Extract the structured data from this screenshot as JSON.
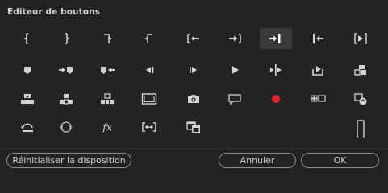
{
  "dialog": {
    "title": "Editeur de boutons"
  },
  "buttons": [
    {
      "id": "mark-in-icon"
    },
    {
      "id": "mark-out-icon"
    },
    {
      "id": "mark-clip-in-icon"
    },
    {
      "id": "mark-clip-out-icon"
    },
    {
      "id": "go-to-in-icon"
    },
    {
      "id": "go-to-out-icon"
    },
    {
      "id": "step-to-next-edit-icon",
      "selected": true
    },
    {
      "id": "step-to-previous-edit-icon"
    },
    {
      "id": "play-in-to-out-icon"
    },
    {
      "id": "add-marker-icon"
    },
    {
      "id": "go-to-next-marker-icon"
    },
    {
      "id": "go-to-previous-marker-icon"
    },
    {
      "id": "step-back-icon"
    },
    {
      "id": "step-forward-icon"
    },
    {
      "id": "play-icon"
    },
    {
      "id": "play-around-icon"
    },
    {
      "id": "export-icon"
    },
    {
      "id": "insert-icon"
    },
    {
      "id": "overwrite-icon"
    },
    {
      "id": "lift-icon"
    },
    {
      "id": "extract-icon"
    },
    {
      "id": "safe-margins-icon"
    },
    {
      "id": "camera-icon"
    },
    {
      "id": "comment-icon"
    },
    {
      "id": "record-icon"
    },
    {
      "id": "multi-camera-icon"
    },
    {
      "id": "proxy-toggle-icon"
    },
    {
      "id": "loop-icon"
    },
    {
      "id": "vr-video-icon"
    },
    {
      "id": "fx-icon"
    },
    {
      "id": "trim-icon"
    },
    {
      "id": "comparison-view-icon"
    },
    {
      "id": "spacer-icon"
    }
  ],
  "footer": {
    "reset_label": "Réinitialiser la disposition",
    "cancel_label": "Annuler",
    "ok_label": "OK"
  },
  "colors": {
    "background": "#232323",
    "icon": "#d4d4d4",
    "record": "#e0262e",
    "selected_bg": "#3a3a3a"
  }
}
